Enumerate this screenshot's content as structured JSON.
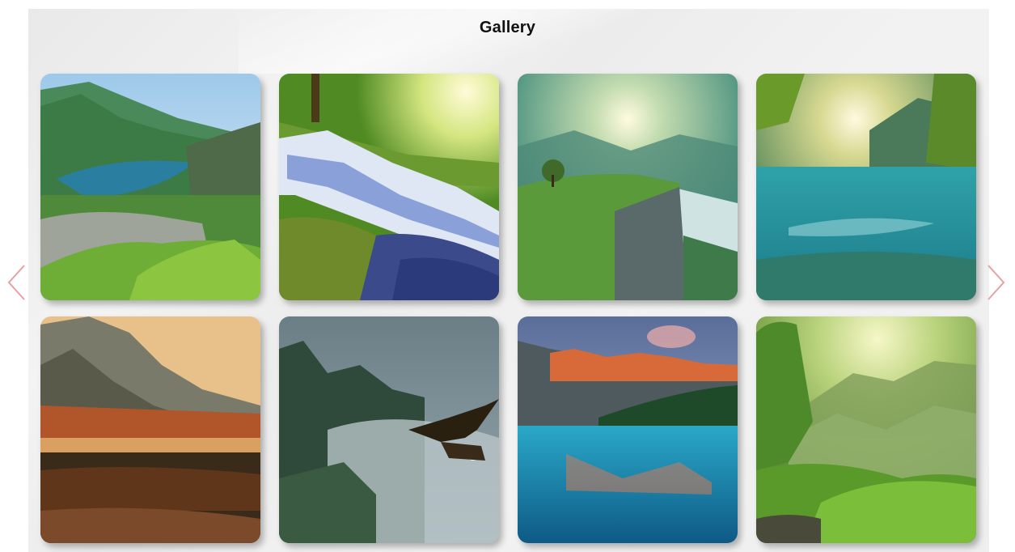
{
  "gallery": {
    "title": "Gallery",
    "images": [
      {
        "name": "mountain-lake-image"
      },
      {
        "name": "forest-waterfall-image"
      },
      {
        "name": "cliff-valley-image"
      },
      {
        "name": "sunlit-lake-image"
      },
      {
        "name": "autumn-pond-image"
      },
      {
        "name": "misty-forest-eagle-image"
      },
      {
        "name": "mountain-reflection-lake-image"
      },
      {
        "name": "green-valley-image"
      }
    ]
  },
  "navigation": {
    "prev_icon": "chevron-left-icon",
    "next_icon": "chevron-right-icon",
    "arrow_color": "#e8a0a0"
  }
}
